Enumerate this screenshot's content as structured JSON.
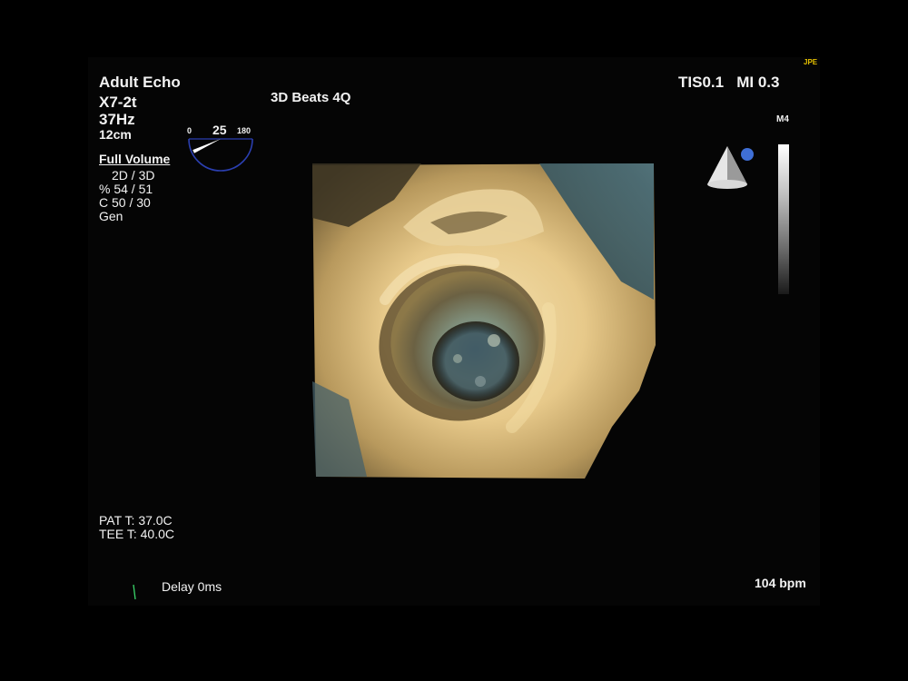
{
  "header": {
    "preset": "Adult Echo",
    "probe": "X7-2t",
    "frame_rate": "37Hz",
    "depth": "12cm",
    "mode_title": "3D Beats 4Q",
    "output": "TIS0.1   MI 0.3",
    "corner_tag": "JPE",
    "map_label": "M4"
  },
  "angle_gauge": {
    "value": "25",
    "min": "0",
    "max": "180",
    "angle_degrees": 25
  },
  "acquisition": {
    "title": "Full Volume",
    "mode": "2D / 3D",
    "gain": "% 54 / 51",
    "compress": "C  50 / 30",
    "freq": "Gen"
  },
  "temperatures": {
    "patient": "PAT T: 37.0C",
    "probe": "TEE T: 40.0C"
  },
  "footer": {
    "delay": "Delay 0ms",
    "heart_rate": "104 bpm"
  },
  "colors": {
    "background": "#000000",
    "text": "#f2f2f2",
    "gauge_blue": "#2b3fb0",
    "orientation_dot": "#3f6fd6",
    "tissue_light": "#f2dca6",
    "tissue_dark": "#3b3020",
    "lumen_blue": "#5f7f86"
  }
}
